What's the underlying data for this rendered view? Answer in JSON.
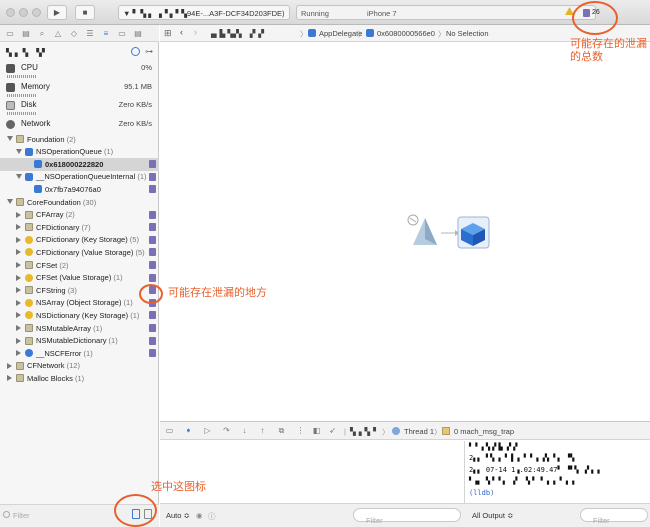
{
  "toolbar": {
    "scheme": "▼ ▘ ▚ ▖ ▗▝ ▖▘▚94E-...A3F-DCF34D203FDE)",
    "status": "Running",
    "device": "iPhone 7",
    "issue_count": "26"
  },
  "navigator": {
    "process_name": "▚▗ ▝▖ ▝▞",
    "gauges": [
      {
        "label": "CPU",
        "value": "0%"
      },
      {
        "label": "Memory",
        "value": "95.1 MB"
      },
      {
        "label": "Disk",
        "value": "Zero KB/s"
      },
      {
        "label": "Network",
        "value": "Zero KB/s"
      }
    ],
    "tree": [
      {
        "label": "Foundation",
        "count": "(2)",
        "depth": 0,
        "icon": "lib",
        "open": true,
        "leak": false
      },
      {
        "label": "NSOperationQueue",
        "count": "(1)",
        "depth": 1,
        "icon": "cube",
        "open": true,
        "leak": false
      },
      {
        "label": "0x618000222820",
        "count": "",
        "depth": 2,
        "icon": "cube",
        "open": null,
        "leak": true,
        "selected": true
      },
      {
        "label": "__NSOperationQueueInternal",
        "count": "(1)",
        "depth": 1,
        "icon": "cube",
        "open": true,
        "leak": true
      },
      {
        "label": "0x7fb7a94076a0",
        "count": "",
        "depth": 2,
        "icon": "cube",
        "open": null,
        "leak": true
      },
      {
        "label": "CoreFoundation",
        "count": "(30)",
        "depth": 0,
        "icon": "lib",
        "open": true,
        "leak": false
      },
      {
        "label": "CFArray",
        "count": "(2)",
        "depth": 1,
        "icon": "lib",
        "open": false,
        "leak": true
      },
      {
        "label": "CFDictionary",
        "count": "(7)",
        "depth": 1,
        "icon": "lib",
        "open": false,
        "leak": true
      },
      {
        "label": "CFDictionary (Key Storage)",
        "count": "(5)",
        "depth": 1,
        "icon": "cls",
        "open": false,
        "leak": true
      },
      {
        "label": "CFDictionary (Value Storage)",
        "count": "(5)",
        "depth": 1,
        "icon": "cls",
        "open": false,
        "leak": true
      },
      {
        "label": "CFSet",
        "count": "(2)",
        "depth": 1,
        "icon": "lib",
        "open": false,
        "leak": true
      },
      {
        "label": "CFSet (Value Storage)",
        "count": "(1)",
        "depth": 1,
        "icon": "cls",
        "open": false,
        "leak": true
      },
      {
        "label": "CFString",
        "count": "(3)",
        "depth": 1,
        "icon": "lib",
        "open": false,
        "leak": true
      },
      {
        "label": "NSArray (Object Storage)",
        "count": "(1)",
        "depth": 1,
        "icon": "cls",
        "open": false,
        "leak": true
      },
      {
        "label": "NSDictionary (Key Storage)",
        "count": "(1)",
        "depth": 1,
        "icon": "cls",
        "open": false,
        "leak": true
      },
      {
        "label": "NSMutableArray",
        "count": "(1)",
        "depth": 1,
        "icon": "lib",
        "open": false,
        "leak": true
      },
      {
        "label": "NSMutableDictionary",
        "count": "(1)",
        "depth": 1,
        "icon": "lib",
        "open": false,
        "leak": true
      },
      {
        "label": "__NSCFError",
        "count": "(1)",
        "depth": 1,
        "icon": "cls-blue",
        "open": false,
        "leak": true
      },
      {
        "label": "CFNetwork",
        "count": "(12)",
        "depth": 0,
        "icon": "lib",
        "open": false,
        "leak": false
      },
      {
        "label": "Malloc Blocks",
        "count": "(1)",
        "depth": 0,
        "icon": "lib",
        "open": false,
        "leak": false
      }
    ],
    "filter_placeholder": "Filter"
  },
  "jumpbar": {
    "app": "▗▖▙ ▚▞▖ ▗▘▞",
    "delegate": "AppDelegate",
    "object": "0x6080000566e0",
    "selection": "No Selection"
  },
  "debugbar": {
    "process": "▚▗▝▖▘",
    "thread": "Thread 1",
    "frame": "0 mach_msg_trap"
  },
  "console": {
    "lines": [
      "▘▝ ▖▚▗▘▙ ▞▗▘",
      "2▖▖ ▘▚ ▖▝ ▌▗ ▘▝ ▖▗▚ ▘▖ ▝▚",
      "2▖▖ 07-14 1▗.02:49.47▘ ▝▘▚ ▗▘▖▗",
      "▘▗▖ ▚▝ ▘▖ ▗▘ ▝▖▘ ▘▗ ▖▝ ▖▗",
      "(lldb)"
    ]
  },
  "bottom": {
    "auto": "Auto ≎",
    "filter_left": "Filter",
    "output": "All Output ≎",
    "filter_right": "Filter"
  },
  "annotations": {
    "total": "可能存在的泄漏\n的总数",
    "leak_spot": "可能存在泄漏的地方",
    "select_icon": "选中这图标"
  },
  "colors": {
    "annotation": "#e8612c",
    "leak_badge": "#7b6fb5",
    "accent_blue": "#3a7ad5"
  }
}
